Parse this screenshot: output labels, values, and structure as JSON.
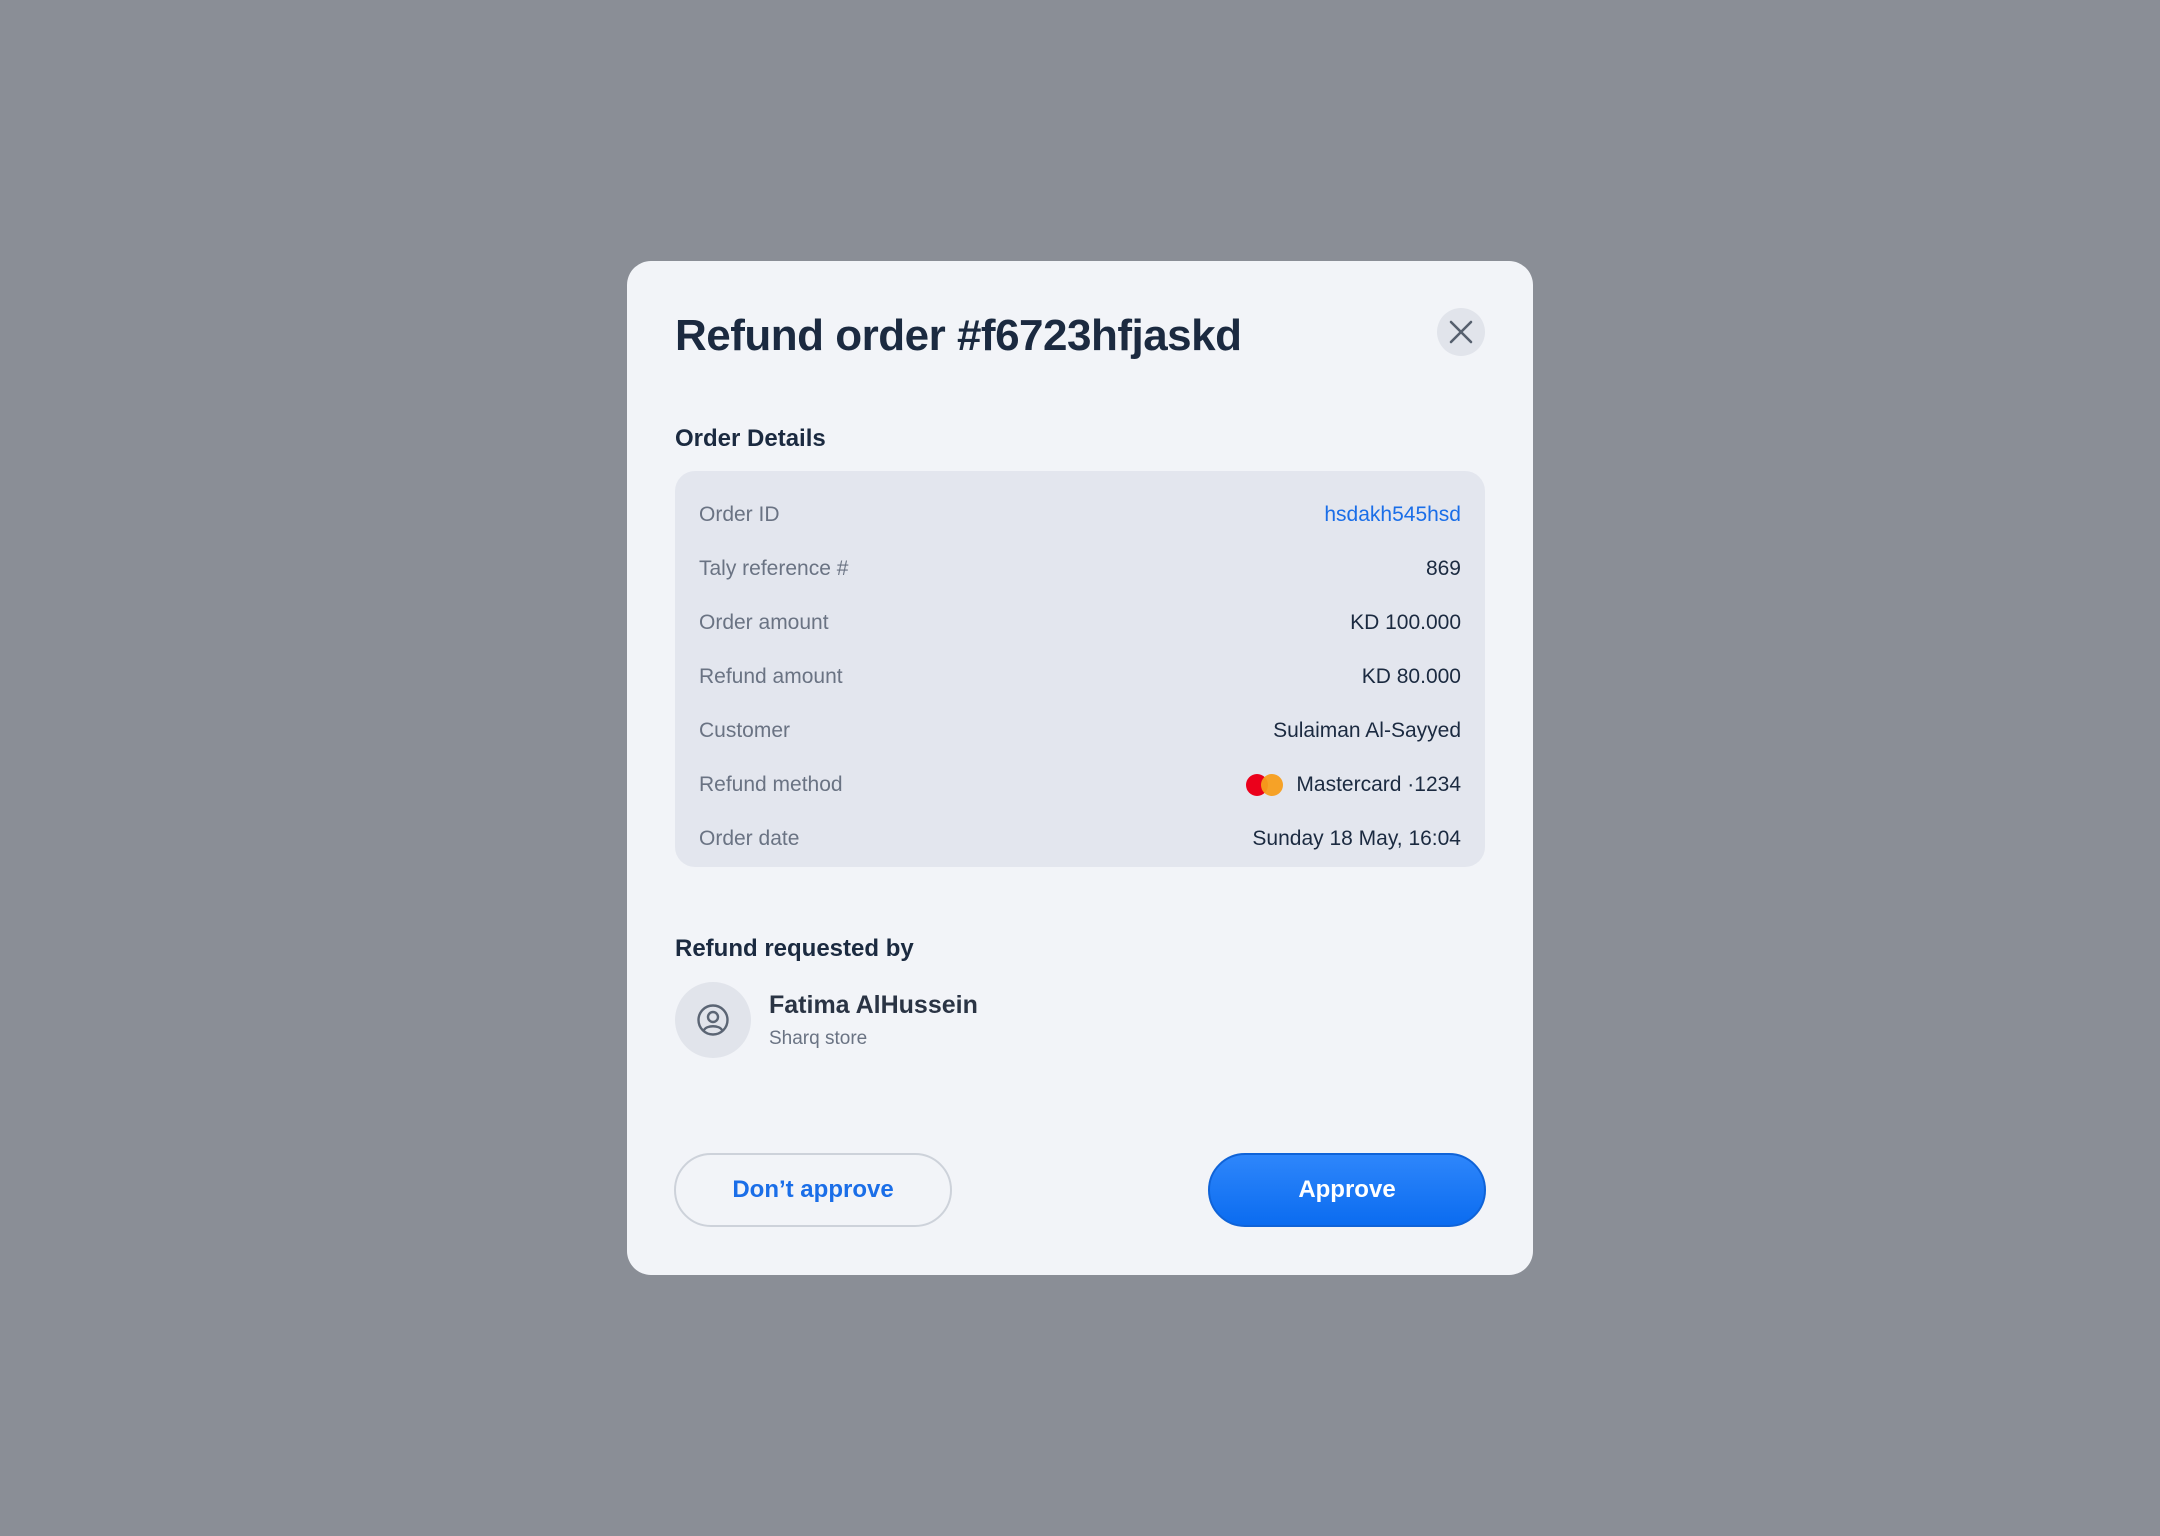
{
  "modal": {
    "title": "Refund order #f6723hfjaskd",
    "close_icon": "close-icon"
  },
  "order_details": {
    "heading": "Order Details",
    "rows": [
      {
        "label": "Order ID",
        "value": "hsdakh545hsd"
      },
      {
        "label": "Taly reference #",
        "value": "869"
      },
      {
        "label": "Order amount",
        "value": "KD 100.000"
      },
      {
        "label": "Refund amount",
        "value": "KD 80.000"
      },
      {
        "label": "Customer",
        "value": "Sulaiman Al-Sayyed"
      },
      {
        "label": "Refund method",
        "value": "Mastercard ·1234",
        "icon": "mastercard-icon"
      },
      {
        "label": "Order date",
        "value": "Sunday 18 May, 16:04"
      }
    ]
  },
  "requested_by": {
    "heading": "Refund requested by",
    "name": "Fatima AlHussein",
    "store": "Sharq store",
    "avatar_icon": "user-avatar-icon"
  },
  "actions": {
    "reject_label": "Don’t approve",
    "approve_label": "Approve"
  },
  "colors": {
    "accent": "#1a6ee8",
    "backdrop": "#8a8e96",
    "modal_bg": "#f2f4f8",
    "card_bg": "#e3e6ee"
  }
}
